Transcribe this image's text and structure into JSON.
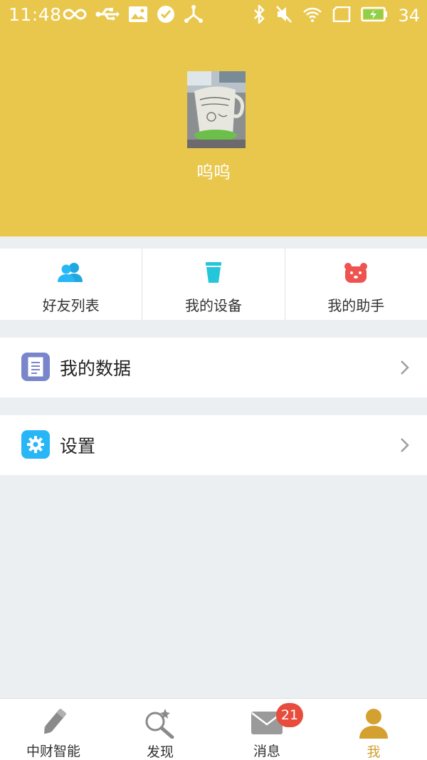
{
  "status_bar": {
    "time": "11:48",
    "battery_level": "34",
    "left_icons": [
      "infinity-icon",
      "usb-icon",
      "image-icon",
      "check-circle-icon",
      "share-icon"
    ],
    "right_icons": [
      "bluetooth-icon",
      "mute-icon",
      "wifi-icon",
      "sim-icon",
      "battery-charging-icon"
    ]
  },
  "profile": {
    "username": "呜呜",
    "header_color": "#e8c74c"
  },
  "quick_actions": [
    {
      "label": "好友列表",
      "icon": "friends-icon",
      "color": "#29b6f6"
    },
    {
      "label": "我的设备",
      "icon": "cup-icon",
      "color": "#26c6da"
    },
    {
      "label": "我的助手",
      "icon": "bear-icon",
      "color": "#ef5350"
    }
  ],
  "menu": [
    {
      "label": "我的数据",
      "icon": "document-icon",
      "color": "#7986cb"
    },
    {
      "label": "设置",
      "icon": "gear-icon",
      "color": "#29b6f6"
    }
  ],
  "bottom_nav": {
    "items": [
      {
        "label": "中财智能",
        "icon": "pen-icon"
      },
      {
        "label": "发现",
        "icon": "discover-icon"
      },
      {
        "label": "消息",
        "icon": "mail-icon",
        "badge": "21"
      },
      {
        "label": "我",
        "icon": "user-icon",
        "active": true
      }
    ],
    "active_color": "#d4a02f"
  }
}
